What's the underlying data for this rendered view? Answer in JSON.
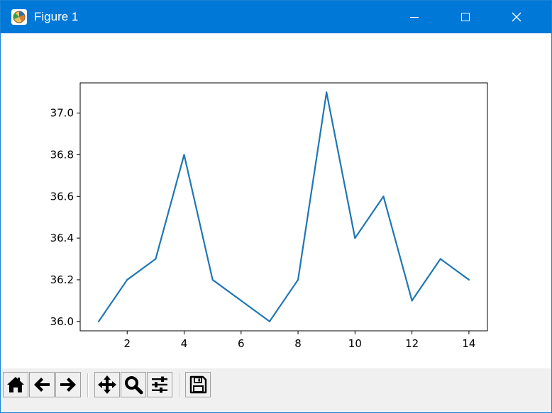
{
  "window": {
    "title": "Figure 1",
    "icon": "matplotlib-figure-icon",
    "controls": [
      "minimize-icon",
      "maximize-icon",
      "close-icon"
    ]
  },
  "toolbar": {
    "buttons": [
      {
        "name": "home",
        "icon": "home-icon"
      },
      {
        "name": "back",
        "icon": "arrow-left-icon"
      },
      {
        "name": "forward",
        "icon": "arrow-right-icon"
      },
      {
        "name": "pan",
        "icon": "move-icon"
      },
      {
        "name": "zoom",
        "icon": "magnifier-icon"
      },
      {
        "name": "configure-subplots",
        "icon": "sliders-icon"
      },
      {
        "name": "save",
        "icon": "floppy-disk-icon"
      }
    ]
  },
  "colors": {
    "titlebar": "#0078d7",
    "line": "#1f77b4"
  },
  "chart_data": {
    "type": "line",
    "title": "",
    "xlabel": "",
    "ylabel": "",
    "x": [
      1,
      2,
      3,
      4,
      5,
      6,
      7,
      8,
      9,
      10,
      11,
      12,
      13,
      14
    ],
    "y": [
      36.0,
      36.2,
      36.3,
      36.8,
      36.2,
      36.1,
      36.0,
      36.2,
      37.1,
      36.4,
      36.6,
      36.1,
      36.3,
      36.2
    ],
    "xlim": [
      0.35,
      14.65
    ],
    "ylim": [
      35.955,
      37.145
    ],
    "xticks": [
      2,
      4,
      6,
      8,
      10,
      12,
      14
    ],
    "xtick_labels": [
      "2",
      "4",
      "6",
      "8",
      "10",
      "12",
      "14"
    ],
    "yticks": [
      36.0,
      36.2,
      36.4,
      36.6,
      36.8,
      37.0
    ],
    "ytick_labels": [
      "36.0",
      "36.2",
      "36.4",
      "36.6",
      "36.8",
      "37.0"
    ],
    "grid": false,
    "legend": "none"
  }
}
